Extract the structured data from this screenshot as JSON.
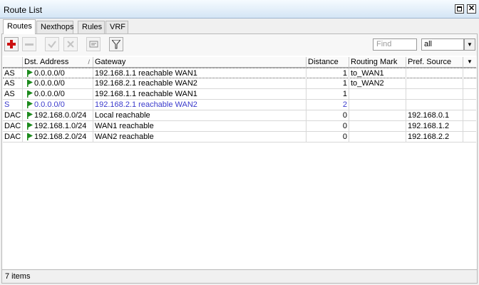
{
  "window": {
    "title": "Route List"
  },
  "tabs": [
    "Routes",
    "Nexthops",
    "Rules",
    "VRF"
  ],
  "toolbar": {
    "find_placeholder": "Find",
    "filter_value": "all"
  },
  "table": {
    "columns": [
      "",
      "Dst. Address",
      "Gateway",
      "Distance",
      "Routing Mark",
      "Pref. Source"
    ],
    "sort_indicator": "/",
    "rows": [
      {
        "flags": "AS",
        "dst": "0.0.0.0/0",
        "gateway": "192.168.1.1 reachable WAN1",
        "distance": "1",
        "mark": "to_WAN1",
        "pref": ""
      },
      {
        "flags": "AS",
        "dst": "0.0.0.0/0",
        "gateway": "192.168.2.1 reachable WAN2",
        "distance": "1",
        "mark": "to_WAN2",
        "pref": ""
      },
      {
        "flags": "AS",
        "dst": "0.0.0.0/0",
        "gateway": "192.168.1.1 reachable WAN1",
        "distance": "1",
        "mark": "",
        "pref": ""
      },
      {
        "flags": "S",
        "dst": "0.0.0.0/0",
        "gateway": "192.168.2.1 reachable WAN2",
        "distance": "2",
        "mark": "",
        "pref": ""
      },
      {
        "flags": "DAC",
        "dst": "192.168.0.0/24",
        "gateway": "Local reachable",
        "distance": "0",
        "mark": "",
        "pref": "192.168.0.1"
      },
      {
        "flags": "DAC",
        "dst": "192.168.1.0/24",
        "gateway": "WAN1 reachable",
        "distance": "0",
        "mark": "",
        "pref": "192.168.1.2"
      },
      {
        "flags": "DAC",
        "dst": "192.168.2.0/24",
        "gateway": "WAN2 reachable",
        "distance": "0",
        "mark": "",
        "pref": "192.168.2.2"
      }
    ]
  },
  "status": {
    "items": "7 items"
  },
  "colors": {
    "inactive_route": "#3a3acc",
    "flag_green": "#1c8a1c",
    "add_red": "#cc1111"
  },
  "icons": [
    "add-icon",
    "remove-icon",
    "enable-icon",
    "disable-icon",
    "comment-icon",
    "filter-icon",
    "route-flag-icon",
    "restore-icon",
    "close-icon",
    "dropdown-arrow-icon",
    "column-menu-icon"
  ]
}
